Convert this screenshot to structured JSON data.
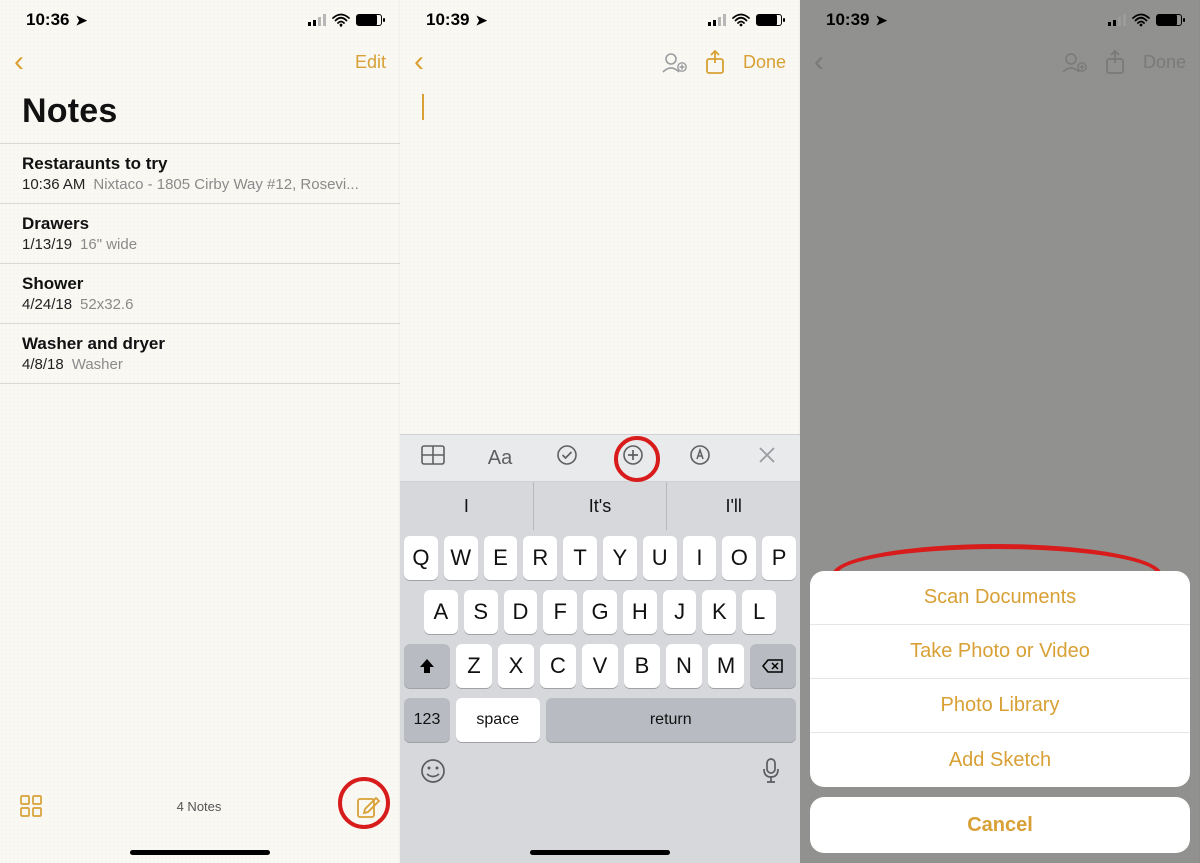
{
  "colors": {
    "accent": "#d8a035",
    "annotation": "#d81b1b"
  },
  "screen1": {
    "status": {
      "time": "10:36"
    },
    "nav": {
      "edit": "Edit"
    },
    "title": "Notes",
    "notes": [
      {
        "title": "Restaraunts to try",
        "when": "10:36 AM",
        "snippet": "Nixtaco - 1805 Cirby Way #12, Rosevi..."
      },
      {
        "title": "Drawers",
        "when": "1/13/19",
        "snippet": "16\" wide"
      },
      {
        "title": "Shower",
        "when": "4/24/18",
        "snippet": "52x32.6"
      },
      {
        "title": "Washer and dryer",
        "when": "4/8/18",
        "snippet": "Washer"
      }
    ],
    "footer": {
      "count": "4 Notes"
    }
  },
  "screen2": {
    "status": {
      "time": "10:39"
    },
    "nav": {
      "done": "Done"
    },
    "suggestions": [
      "I",
      "It's",
      "I'll"
    ],
    "keyboard": {
      "row1": [
        "Q",
        "W",
        "E",
        "R",
        "T",
        "Y",
        "U",
        "I",
        "O",
        "P"
      ],
      "row2": [
        "A",
        "S",
        "D",
        "F",
        "G",
        "H",
        "J",
        "K",
        "L"
      ],
      "row3": [
        "Z",
        "X",
        "C",
        "V",
        "B",
        "N",
        "M"
      ],
      "numKey": "123",
      "spaceKey": "space",
      "returnKey": "return"
    },
    "formatBar": {
      "aa": "Aa"
    }
  },
  "screen3": {
    "status": {
      "time": "10:39"
    },
    "nav": {
      "done": "Done"
    },
    "sheet": {
      "items": [
        "Scan Documents",
        "Take Photo or Video",
        "Photo Library",
        "Add Sketch"
      ],
      "cancel": "Cancel"
    }
  }
}
